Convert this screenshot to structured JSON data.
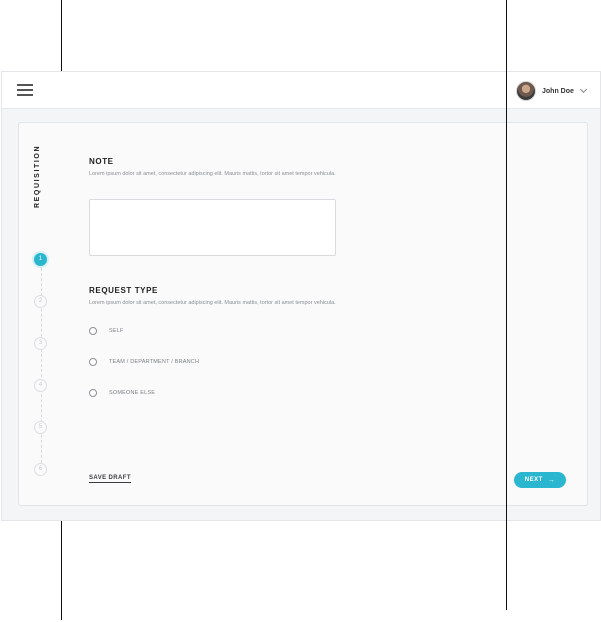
{
  "header": {
    "user_name": "John Doe"
  },
  "sidebar": {
    "title": "REQUISITION",
    "steps": [
      {
        "label": "1",
        "active": true
      },
      {
        "label": "2",
        "active": false
      },
      {
        "label": "3",
        "active": false
      },
      {
        "label": "4",
        "active": false
      },
      {
        "label": "5",
        "active": false
      },
      {
        "label": "6",
        "active": false
      }
    ]
  },
  "note": {
    "title": "NOTE",
    "description": "Lorem ipsum dolor sit amet, consectetur adipiscing elit. Mauris mattis, tortor sit amet tempor vehicula.",
    "value": "",
    "placeholder": ""
  },
  "request_type": {
    "title": "REQUEST TYPE",
    "description": "Lorem ipsum dolor sit amet, consectetur adipiscing elit. Mauris mattis, tortor sit amet tempor vehicula.",
    "options": [
      {
        "label": "SELF",
        "selected": false
      },
      {
        "label": "TEAM / DEPARTMENT / BRANCH",
        "selected": false
      },
      {
        "label": "SOMEONE ELSE",
        "selected": false
      }
    ]
  },
  "actions": {
    "save_draft": "SAVE DRAFT",
    "next": "NEXT",
    "next_arrow": "→"
  },
  "colors": {
    "accent": "#2bb6cf"
  }
}
